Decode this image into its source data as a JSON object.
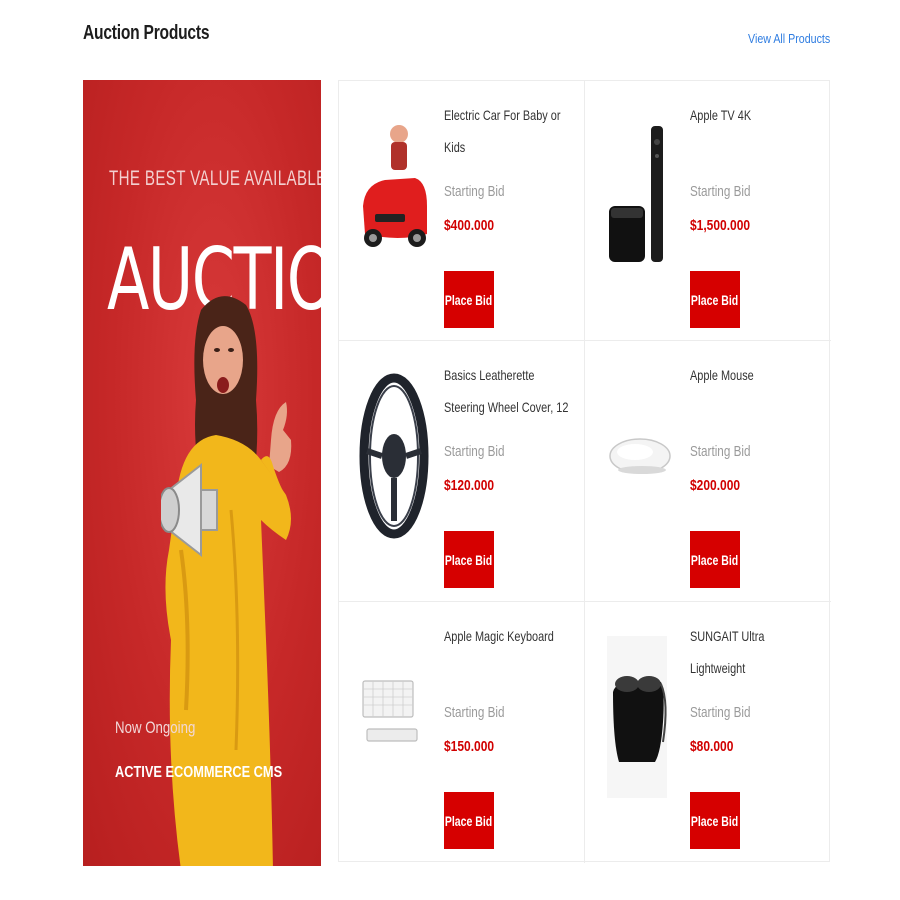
{
  "header": {
    "title": "Auction Products",
    "view_all_label": "View All Products"
  },
  "banner": {
    "tagline": "THE BEST VALUE AVAILABLE",
    "headline": "AUCTION",
    "status": "Now Ongoing",
    "brand": "ACTIVE ECOMMERCE CMS",
    "background_color": "#c62828"
  },
  "products": [
    {
      "name": "Electric Car For Baby or Kids",
      "bid_label": "Starting Bid",
      "price": "$400.000",
      "button_label": "Place Bid",
      "icon": "toy-car-icon"
    },
    {
      "name": "Apple TV 4K",
      "bid_label": "Starting Bid",
      "price": "$1,500.000",
      "button_label": "Place Bid",
      "icon": "apple-tv-icon"
    },
    {
      "name": "Basics Leatherette Steering Wheel Cover, 12",
      "bid_label": "Starting Bid",
      "price": "$120.000",
      "button_label": "Place Bid",
      "icon": "steering-wheel-icon"
    },
    {
      "name": "Apple Mouse",
      "bid_label": "Starting Bid",
      "price": "$200.000",
      "button_label": "Place Bid",
      "icon": "mouse-icon"
    },
    {
      "name": "Apple Magic Keyboard",
      "bid_label": "Starting Bid",
      "price": "$150.000",
      "button_label": "Place Bid",
      "icon": "keyboard-icon"
    },
    {
      "name": "SUNGAIT Ultra Lightweight",
      "bid_label": "Starting Bid",
      "price": "$80.000",
      "button_label": "Place Bid",
      "icon": "sunglasses-icon"
    }
  ],
  "colors": {
    "accent": "#d60000",
    "link": "#2f7de1",
    "muted_text": "#9a9a9a"
  }
}
